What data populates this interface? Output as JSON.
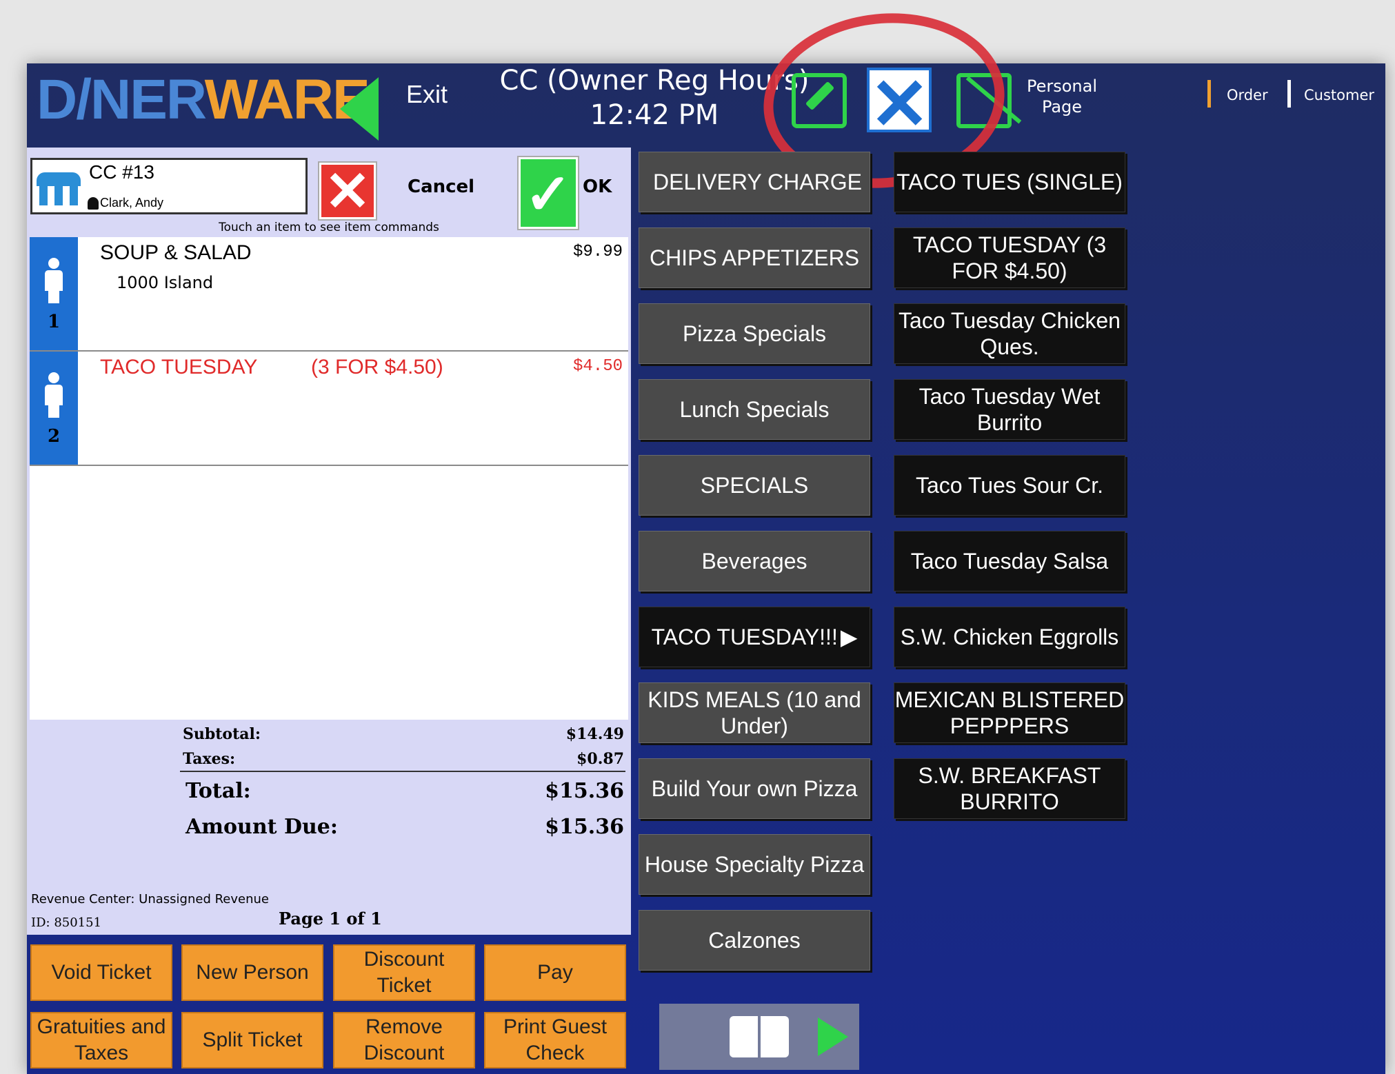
{
  "header": {
    "logo_part1": "D/NER",
    "logo_part2": "WARE",
    "exit_label": "Exit",
    "mode": "CC (Owner Reg Hours)",
    "time": "12:42 PM",
    "personal_page": "Personal Page",
    "tabs": [
      "Order",
      "Customer"
    ]
  },
  "ticket": {
    "table": "CC #13",
    "server": "Clark, Andy",
    "cancel_label": "Cancel",
    "ok_label": "OK",
    "hint": "Touch an item to see item commands",
    "seats": [
      {
        "number": "1",
        "items": [
          {
            "name": "SOUP & SALAD",
            "modifier": "1000 Island",
            "price": "$9.99"
          }
        ]
      },
      {
        "number": "2",
        "items": [
          {
            "name": "TACO TUESDAY",
            "name_suffix": "(3 FOR $4.50)",
            "price": "$4.50"
          }
        ]
      }
    ],
    "totals": {
      "subtotal_label": "Subtotal:",
      "subtotal": "$14.49",
      "taxes_label": "Taxes:",
      "taxes": "$0.87",
      "total_label": "Total:",
      "total": "$15.36",
      "due_label": "Amount Due:",
      "due": "$15.36"
    },
    "revenue_center": "Revenue Center: Unassigned Revenue",
    "id": "ID: 850151",
    "page": "Page 1 of 1"
  },
  "actions": [
    "Void Ticket",
    "New Person",
    "Discount Ticket",
    "Pay",
    "Gratuities and Taxes",
    "Split Ticket",
    "Remove Discount",
    "Print Guest Check"
  ],
  "categories": [
    "DELIVERY CHARGE",
    "CHIPS APPETIZERS",
    "Pizza Specials",
    "Lunch Specials",
    "SPECIALS",
    "Beverages",
    "TACO TUESDAY!!!",
    "KIDS MEALS (10 and Under)",
    "Build Your own Pizza",
    "House Specialty Pizza",
    "Calzones"
  ],
  "items": [
    "TACO TUES (SINGLE)",
    "TACO TUESDAY (3 FOR $4.50)",
    "Taco Tuesday Chicken Ques.",
    "Taco Tuesday Wet Burrito",
    "Taco Tues Sour Cr.",
    "Taco Tuesday Salsa",
    "S.W. Chicken Eggrolls",
    "MEXICAN BLISTERED PEPPPERS",
    "S.W. BREAKFAST BURRITO"
  ],
  "icons": {
    "edit": "edit-icon",
    "close": "close-x-icon",
    "note": "note-icon",
    "book": "book-icon",
    "play": "play-icon",
    "back": "back-arrow-icon"
  },
  "colors": {
    "accent_green": "#2fd34a",
    "action_orange": "#f29a2e",
    "void_red": "#e02a2a",
    "annotation_red": "#d9303a"
  }
}
